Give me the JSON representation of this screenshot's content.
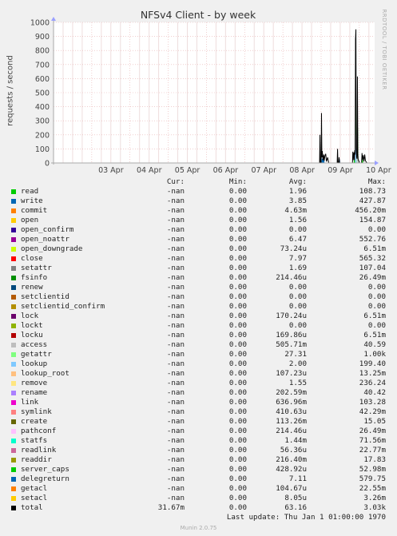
{
  "chart_data": {
    "type": "line",
    "title": "NFSv4 Client - by week",
    "ylabel": "requests / second",
    "right_label": "RRDTOOL / TOBI OETIKER",
    "ylim": [
      0,
      1000
    ],
    "yticks": [
      0,
      100,
      200,
      300,
      400,
      500,
      600,
      700,
      800,
      900,
      1000
    ],
    "xlim": [
      0,
      8.4
    ],
    "xticks": [
      {
        "label": "03 Apr",
        "x": 1
      },
      {
        "label": "04 Apr",
        "x": 2
      },
      {
        "label": "05 Apr",
        "x": 3
      },
      {
        "label": "06 Apr",
        "x": 4
      },
      {
        "label": "07 Apr",
        "x": 5
      },
      {
        "label": "08 Apr",
        "x": 6
      },
      {
        "label": "09 Apr",
        "x": 7
      },
      {
        "label": "10 Apr",
        "x": 8
      }
    ],
    "grid": true,
    "total_series": {
      "name": "total",
      "points": [
        [
          6.96,
          0
        ],
        [
          6.97,
          200
        ],
        [
          6.98,
          0
        ],
        [
          7.0,
          0
        ],
        [
          7.01,
          355
        ],
        [
          7.02,
          40
        ],
        [
          7.03,
          85
        ],
        [
          7.05,
          20
        ],
        [
          7.07,
          60
        ],
        [
          7.08,
          15
        ],
        [
          7.1,
          50
        ],
        [
          7.12,
          65
        ],
        [
          7.14,
          10
        ],
        [
          7.17,
          40
        ],
        [
          7.2,
          0
        ],
        [
          7.42,
          0
        ],
        [
          7.43,
          100
        ],
        [
          7.44,
          0
        ],
        [
          7.46,
          0
        ],
        [
          7.47,
          40
        ],
        [
          7.48,
          0
        ],
        [
          7.82,
          0
        ],
        [
          7.83,
          80
        ],
        [
          7.84,
          20
        ],
        [
          7.85,
          60
        ],
        [
          7.86,
          75
        ],
        [
          7.87,
          20
        ],
        [
          7.88,
          90
        ],
        [
          7.89,
          60
        ],
        [
          7.9,
          880
        ],
        [
          7.91,
          950
        ],
        [
          7.92,
          100
        ],
        [
          7.93,
          40
        ],
        [
          7.94,
          30
        ],
        [
          7.95,
          615
        ],
        [
          7.96,
          60
        ],
        [
          7.97,
          20
        ],
        [
          7.99,
          15
        ],
        [
          8.0,
          0
        ],
        [
          8.06,
          0
        ],
        [
          8.07,
          70
        ],
        [
          8.08,
          20
        ],
        [
          8.1,
          55
        ],
        [
          8.12,
          10
        ],
        [
          8.14,
          60
        ],
        [
          8.16,
          15
        ],
        [
          8.2,
          0
        ]
      ]
    },
    "component_series": [
      {
        "name": "getattr",
        "color": "#7EE07E",
        "points": [
          [
            7.88,
            0
          ],
          [
            7.89,
            40
          ],
          [
            7.9,
            350
          ],
          [
            7.91,
            500
          ],
          [
            7.92,
            50
          ],
          [
            7.93,
            0
          ],
          [
            7.95,
            0
          ],
          [
            7.96,
            250
          ],
          [
            7.97,
            0
          ]
        ]
      },
      {
        "name": "access",
        "color": "#CCCCCC",
        "points": [
          [
            7.88,
            0
          ],
          [
            7.9,
            120
          ],
          [
            7.91,
            200
          ],
          [
            7.92,
            0
          ],
          [
            7.95,
            0
          ],
          [
            7.96,
            100
          ],
          [
            7.97,
            0
          ]
        ]
      },
      {
        "name": "lookup",
        "color": "#8FC7F5",
        "points": [
          [
            7.0,
            0
          ],
          [
            7.01,
            40
          ],
          [
            7.02,
            0
          ],
          [
            7.89,
            0
          ],
          [
            7.9,
            80
          ],
          [
            7.91,
            100
          ],
          [
            7.92,
            0
          ]
        ]
      },
      {
        "name": "write",
        "color": "#0066B3",
        "points": [
          [
            7.02,
            0
          ],
          [
            7.03,
            30
          ],
          [
            7.05,
            10
          ],
          [
            7.07,
            45
          ],
          [
            7.08,
            0
          ],
          [
            7.47,
            0
          ],
          [
            7.48,
            25
          ],
          [
            7.49,
            0
          ]
        ]
      },
      {
        "name": "read",
        "color": "#00CC00",
        "points": [
          [
            7.86,
            0
          ],
          [
            7.87,
            30
          ],
          [
            7.88,
            0
          ],
          [
            8.07,
            0
          ],
          [
            8.08,
            40
          ],
          [
            8.09,
            0
          ]
        ]
      }
    ],
    "legend_header": [
      "Cur:",
      "Min:",
      "Avg:",
      "Max:"
    ],
    "legend": [
      {
        "name": "read",
        "color": "#00CC00",
        "cur": "-nan",
        "min": "0.00",
        "avg": "1.96",
        "max": "108.73"
      },
      {
        "name": "write",
        "color": "#0066B3",
        "cur": "-nan",
        "min": "0.00",
        "avg": "3.85",
        "max": "427.87"
      },
      {
        "name": "commit",
        "color": "#FF8000",
        "cur": "-nan",
        "min": "0.00",
        "avg": "4.63m",
        "max": "456.20m"
      },
      {
        "name": "open",
        "color": "#FFCC00",
        "cur": "-nan",
        "min": "0.00",
        "avg": "1.56",
        "max": "154.87"
      },
      {
        "name": "open_confirm",
        "color": "#330099",
        "cur": "-nan",
        "min": "0.00",
        "avg": "0.00",
        "max": "0.00"
      },
      {
        "name": "open_noattr",
        "color": "#990099",
        "cur": "-nan",
        "min": "0.00",
        "avg": "6.47",
        "max": "552.76"
      },
      {
        "name": "open_downgrade",
        "color": "#CCFF00",
        "cur": "-nan",
        "min": "0.00",
        "avg": "73.24u",
        "max": "6.51m"
      },
      {
        "name": "close",
        "color": "#FF0000",
        "cur": "-nan",
        "min": "0.00",
        "avg": "7.97",
        "max": "565.32"
      },
      {
        "name": "setattr",
        "color": "#808080",
        "cur": "-nan",
        "min": "0.00",
        "avg": "1.69",
        "max": "107.04"
      },
      {
        "name": "fsinfo",
        "color": "#008F00",
        "cur": "-nan",
        "min": "0.00",
        "avg": "214.46u",
        "max": "26.49m"
      },
      {
        "name": "renew",
        "color": "#00487D",
        "cur": "-nan",
        "min": "0.00",
        "avg": "0.00",
        "max": "0.00"
      },
      {
        "name": "setclientid",
        "color": "#B35A00",
        "cur": "-nan",
        "min": "0.00",
        "avg": "0.00",
        "max": "0.00"
      },
      {
        "name": "setclientid_confirm",
        "color": "#B38F00",
        "cur": "-nan",
        "min": "0.00",
        "avg": "0.00",
        "max": "0.00"
      },
      {
        "name": "lock",
        "color": "#6B006B",
        "cur": "-nan",
        "min": "0.00",
        "avg": "170.24u",
        "max": "6.51m"
      },
      {
        "name": "lockt",
        "color": "#8FB300",
        "cur": "-nan",
        "min": "0.00",
        "avg": "0.00",
        "max": "0.00"
      },
      {
        "name": "locku",
        "color": "#B30000",
        "cur": "-nan",
        "min": "0.00",
        "avg": "169.86u",
        "max": "6.51m"
      },
      {
        "name": "access",
        "color": "#BEBEBE",
        "cur": "-nan",
        "min": "0.00",
        "avg": "505.71m",
        "max": "40.59"
      },
      {
        "name": "getattr",
        "color": "#80FF80",
        "cur": "-nan",
        "min": "0.00",
        "avg": "27.31",
        "max": "1.00k"
      },
      {
        "name": "lookup",
        "color": "#80C9FF",
        "cur": "-nan",
        "min": "0.00",
        "avg": "2.00",
        "max": "199.40"
      },
      {
        "name": "lookup_root",
        "color": "#FFC080",
        "cur": "-nan",
        "min": "0.00",
        "avg": "107.23u",
        "max": "13.25m"
      },
      {
        "name": "remove",
        "color": "#FFE680",
        "cur": "-nan",
        "min": "0.00",
        "avg": "1.55",
        "max": "236.24"
      },
      {
        "name": "rename",
        "color": "#AA80FF",
        "cur": "-nan",
        "min": "0.00",
        "avg": "202.59m",
        "max": "40.42"
      },
      {
        "name": "link",
        "color": "#EE00CC",
        "cur": "-nan",
        "min": "0.00",
        "avg": "636.96m",
        "max": "103.28"
      },
      {
        "name": "symlink",
        "color": "#FF8080",
        "cur": "-nan",
        "min": "0.00",
        "avg": "410.63u",
        "max": "42.29m"
      },
      {
        "name": "create",
        "color": "#666600",
        "cur": "-nan",
        "min": "0.00",
        "avg": "113.26m",
        "max": "15.05"
      },
      {
        "name": "pathconf",
        "color": "#FFBFFF",
        "cur": "-nan",
        "min": "0.00",
        "avg": "214.46u",
        "max": "26.49m"
      },
      {
        "name": "statfs",
        "color": "#00FFCC",
        "cur": "-nan",
        "min": "0.00",
        "avg": "1.44m",
        "max": "71.56m"
      },
      {
        "name": "readlink",
        "color": "#CC6699",
        "cur": "-nan",
        "min": "0.00",
        "avg": "56.36u",
        "max": "22.77m"
      },
      {
        "name": "readdir",
        "color": "#999900",
        "cur": "-nan",
        "min": "0.00",
        "avg": "216.40m",
        "max": "17.83"
      },
      {
        "name": "server_caps",
        "color": "#00CC00",
        "cur": "-nan",
        "min": "0.00",
        "avg": "428.92u",
        "max": "52.98m"
      },
      {
        "name": "delegreturn",
        "color": "#0066B3",
        "cur": "-nan",
        "min": "0.00",
        "avg": "7.11",
        "max": "579.75"
      },
      {
        "name": "getacl",
        "color": "#FF8000",
        "cur": "-nan",
        "min": "0.00",
        "avg": "104.67u",
        "max": "22.55m"
      },
      {
        "name": "setacl",
        "color": "#FFCC00",
        "cur": "-nan",
        "min": "0.00",
        "avg": "8.05u",
        "max": "3.26m"
      },
      {
        "name": "total",
        "color": "#000000",
        "cur": "31.67m",
        "min": "0.00",
        "avg": "63.16",
        "max": "3.03k"
      }
    ]
  },
  "last_update": "Last update: Thu Jan  1 01:00:00 1970",
  "footer": "Munin 2.0.75"
}
